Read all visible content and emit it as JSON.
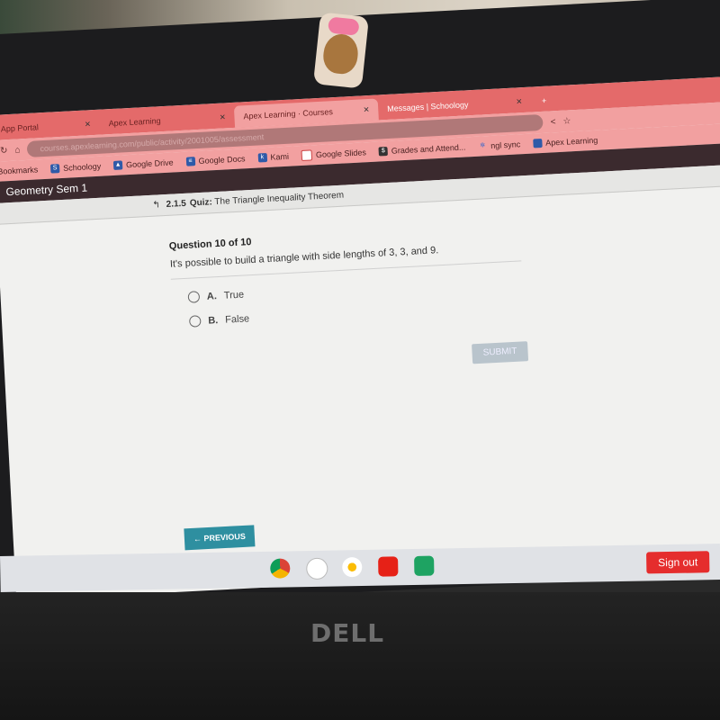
{
  "browser": {
    "tabs": [
      {
        "label": "App Portal"
      },
      {
        "label": "Apex Learning"
      },
      {
        "label": "Apex Learning · Courses"
      },
      {
        "label": "Messages | Schoology"
      }
    ],
    "url": "courses.apexlearning.com/public/activity/2001005/assessment",
    "bookmarks": [
      "Bookmarks",
      "Schoology",
      "Google Drive",
      "Google Docs",
      "Kami",
      "Google Slides",
      "Grades and Attend...",
      "ngl sync",
      "Apex Learning"
    ]
  },
  "course": {
    "title": "Geometry Sem 1"
  },
  "breadcrumb": {
    "number": "2.1.5",
    "type": "Quiz:",
    "title": "The Triangle Inequality Theorem"
  },
  "question": {
    "counter": "Question 10 of 10",
    "text": "It's possible to build a triangle with side lengths of 3, 3, and 9.",
    "options": [
      {
        "letter": "A.",
        "label": "True",
        "selected": false
      },
      {
        "letter": "B.",
        "label": "False",
        "selected": false
      }
    ],
    "submit_label": "SUBMIT",
    "previous_label": "← PREVIOUS"
  },
  "shelf": {
    "signout_label": "Sign out",
    "apps": [
      "chrome-icon",
      "canvas-icon",
      "photos-icon",
      "youtube-icon",
      "classroom-icon"
    ]
  },
  "laptop": {
    "brand": "DELL"
  },
  "colors": {
    "tabbar": "#e46a6a",
    "course_bar": "#3b2a2e",
    "previous": "#2e8fa0",
    "signout": "#e52d2d"
  }
}
